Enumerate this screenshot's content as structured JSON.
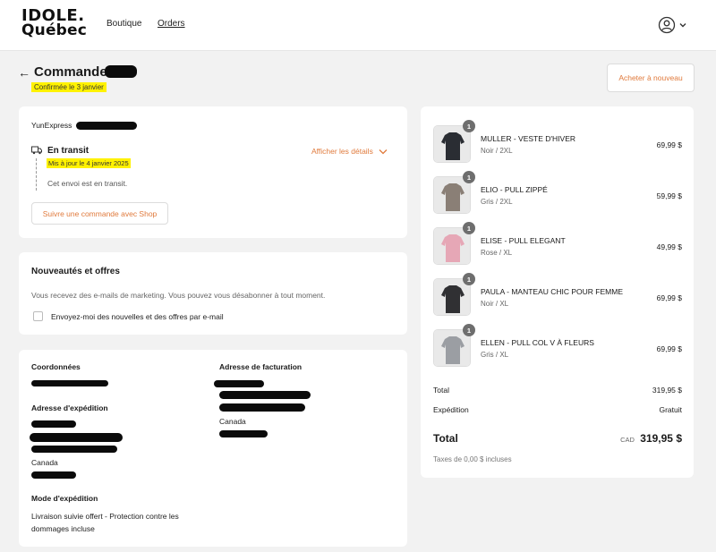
{
  "header": {
    "logo_line1": "IDOLE.",
    "logo_line2": "Québec",
    "nav": {
      "shop": "Boutique",
      "orders": "Orders"
    },
    "account_icon": "user-circle-icon"
  },
  "order": {
    "title": "Commande",
    "confirmed": "Confirmée le 3 janvier",
    "buy_again": "Acheter à nouveau"
  },
  "shipment": {
    "carrier": "YunExpress",
    "status": "En transit",
    "updated": "Mis à jour le 4 janvier 2025",
    "details_link": "Afficher les détails",
    "message": "Cet envoi est en transit.",
    "track_button": "Suivre une commande avec Shop"
  },
  "news": {
    "title": "Nouveautés et offres",
    "text": "Vous recevez des e-mails de marketing. Vous pouvez vous désabonner à tout moment.",
    "checkbox_label": "Envoyez-moi des nouvelles et des offres par e-mail",
    "checked": false
  },
  "info": {
    "contact_label": "Coordonnées",
    "shipping_address_label": "Adresse d'expédition",
    "shipping_country": "Canada",
    "billing_address_label": "Adresse de facturation",
    "billing_country": "Canada",
    "shipping_method_label": "Mode d'expédition",
    "shipping_method_line1": "Livraison suivie offert - Protection contre les",
    "shipping_method_line2": "dommages incluse"
  },
  "items": [
    {
      "qty": "1",
      "name": "MULLER - VESTE D'HIVER",
      "variant": "Noir / 2XL",
      "price": "69,99 $",
      "thumb_color": "#2a2d33"
    },
    {
      "qty": "1",
      "name": "ELIO - PULL ZIPPÉ",
      "variant": "Gris / 2XL",
      "price": "59,99 $",
      "thumb_color": "#8a7f76"
    },
    {
      "qty": "1",
      "name": "ELISE - PULL ELEGANT",
      "variant": "Rose / XL",
      "price": "49,99 $",
      "thumb_color": "#e6a7b6"
    },
    {
      "qty": "1",
      "name": "PAULA - MANTEAU CHIC POUR FEMME",
      "variant": "Noir / XL",
      "price": "69,99 $",
      "thumb_color": "#303033"
    },
    {
      "qty": "1",
      "name": "ELLEN - PULL COL V À FLEURS",
      "variant": "Gris / XL",
      "price": "69,99 $",
      "thumb_color": "#9b9ea3"
    }
  ],
  "summary": {
    "subtotal_label": "Total",
    "subtotal": "319,95 $",
    "shipping_label": "Expédition",
    "shipping": "Gratuit",
    "total_label": "Total",
    "currency": "CAD",
    "total": "319,95 $",
    "taxes": "Taxes de 0,00 $ incluses"
  },
  "colors": {
    "accent": "#e07a3c",
    "highlight": "#fff200",
    "background": "#f2f2f2"
  }
}
